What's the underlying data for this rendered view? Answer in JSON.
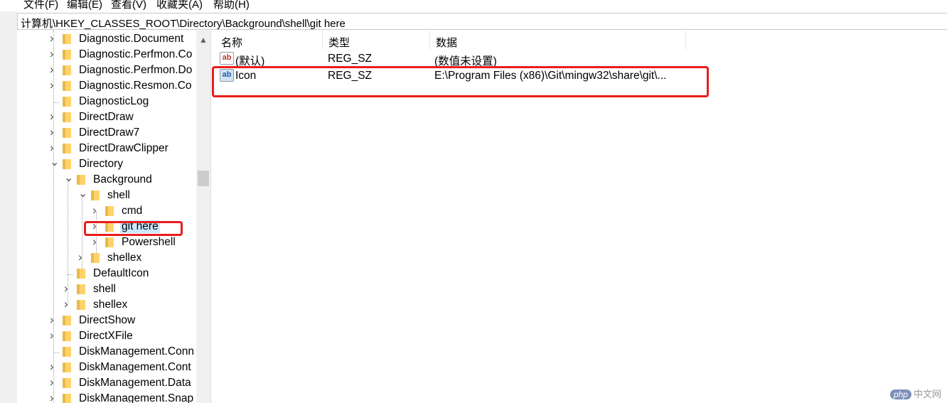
{
  "menu": {
    "items": [
      "文件(F)",
      "编辑(E)",
      "查看(V)",
      "收藏夹(A)",
      "帮助(H)"
    ]
  },
  "address": {
    "path": "计算机\\HKEY_CLASSES_ROOT\\Directory\\Background\\shell\\git here"
  },
  "tree": {
    "items": [
      {
        "label": "Diagnostic.Document",
        "expanded": false
      },
      {
        "label": "Diagnostic.Perfmon.Co",
        "expanded": false
      },
      {
        "label": "Diagnostic.Perfmon.Do",
        "expanded": false
      },
      {
        "label": "Diagnostic.Resmon.Co",
        "expanded": false
      },
      {
        "label": "DiagnosticLog",
        "expanded": false
      },
      {
        "label": "DirectDraw",
        "expanded": false
      },
      {
        "label": "DirectDraw7",
        "expanded": false
      },
      {
        "label": "DirectDrawClipper",
        "expanded": false
      },
      {
        "label": "Directory",
        "expanded": true
      },
      {
        "label": "Background",
        "expanded": true
      },
      {
        "label": "shell",
        "expanded": true
      },
      {
        "label": "cmd",
        "expanded": false
      },
      {
        "label": "git here",
        "expanded": false,
        "selected": true
      },
      {
        "label": "Powershell",
        "expanded": false
      },
      {
        "label": "shellex",
        "expanded": false
      },
      {
        "label": "DefaultIcon",
        "expanded": false
      },
      {
        "label": "shell",
        "expanded": false
      },
      {
        "label": "shellex",
        "expanded": false
      },
      {
        "label": "DirectShow",
        "expanded": false
      },
      {
        "label": "DirectXFile",
        "expanded": false
      },
      {
        "label": "DiskManagement.Conn",
        "expanded": false
      },
      {
        "label": "DiskManagement.Cont",
        "expanded": false
      },
      {
        "label": "DiskManagement.Data",
        "expanded": false
      },
      {
        "label": "DiskManagement.Snap",
        "expanded": false
      }
    ]
  },
  "values": {
    "columns": [
      "名称",
      "类型",
      "数据"
    ],
    "rows": [
      {
        "name": "(默认)",
        "type": "REG_SZ",
        "data": "(数值未设置)",
        "icon": "ab-string-icon"
      },
      {
        "name": "Icon",
        "type": "REG_SZ",
        "data": "E:\\Program Files (x86)\\Git\\mingw32\\share\\git\\...",
        "icon": "ab-string-icon"
      }
    ]
  },
  "watermark": {
    "logo": "php",
    "text": "中文网"
  },
  "colors": {
    "highlight": "#ea1c1c",
    "folder": "#ffd36b",
    "selection": "#cce8ff"
  }
}
